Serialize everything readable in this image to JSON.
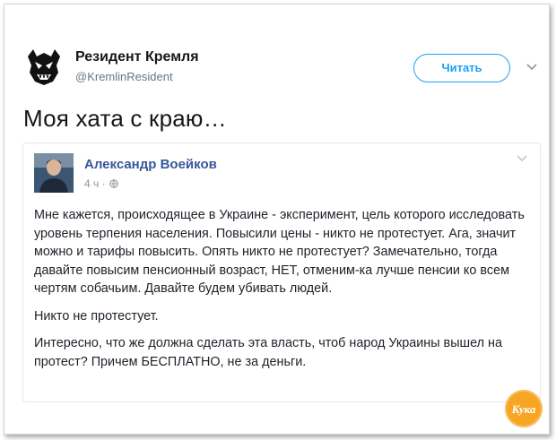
{
  "tweet": {
    "author_name": "Резидент Кремля",
    "author_handle": "@KremlinResident",
    "follow_label": "Читать",
    "text": "Моя хата с краю…"
  },
  "card": {
    "author_name": "Александр Воейков",
    "time": "4 ч ·",
    "paragraphs": [
      "Мне кажется, происходящее в Украине - эксперимент, цель которого исследовать уровень терпения населения. Повысили цены - никто не протестует. Ага, значит можно и тарифы повысить. Опять никто не протестует? Замечательно, тогда давайте повысим пенсионный возраст, НЕТ, отменим-ка лучше пенсии ко всем чертям собачьим. Давайте будем убивать людей.",
      "Никто не протестует.",
      "Интересно, что же должна сделать эта власть, чтоб народ Украины вышел на протест? Причем БЕСПЛАТНО, не за деньги."
    ]
  },
  "watermark": {
    "text": "Кука",
    "color": "#f6a623"
  },
  "colors": {
    "accent": "#1da1f2",
    "facebook_name": "#365899"
  },
  "icons": {
    "avatar": "masked-figure-avatar",
    "caret": "chevron-down-icon",
    "globe": "globe-icon"
  }
}
